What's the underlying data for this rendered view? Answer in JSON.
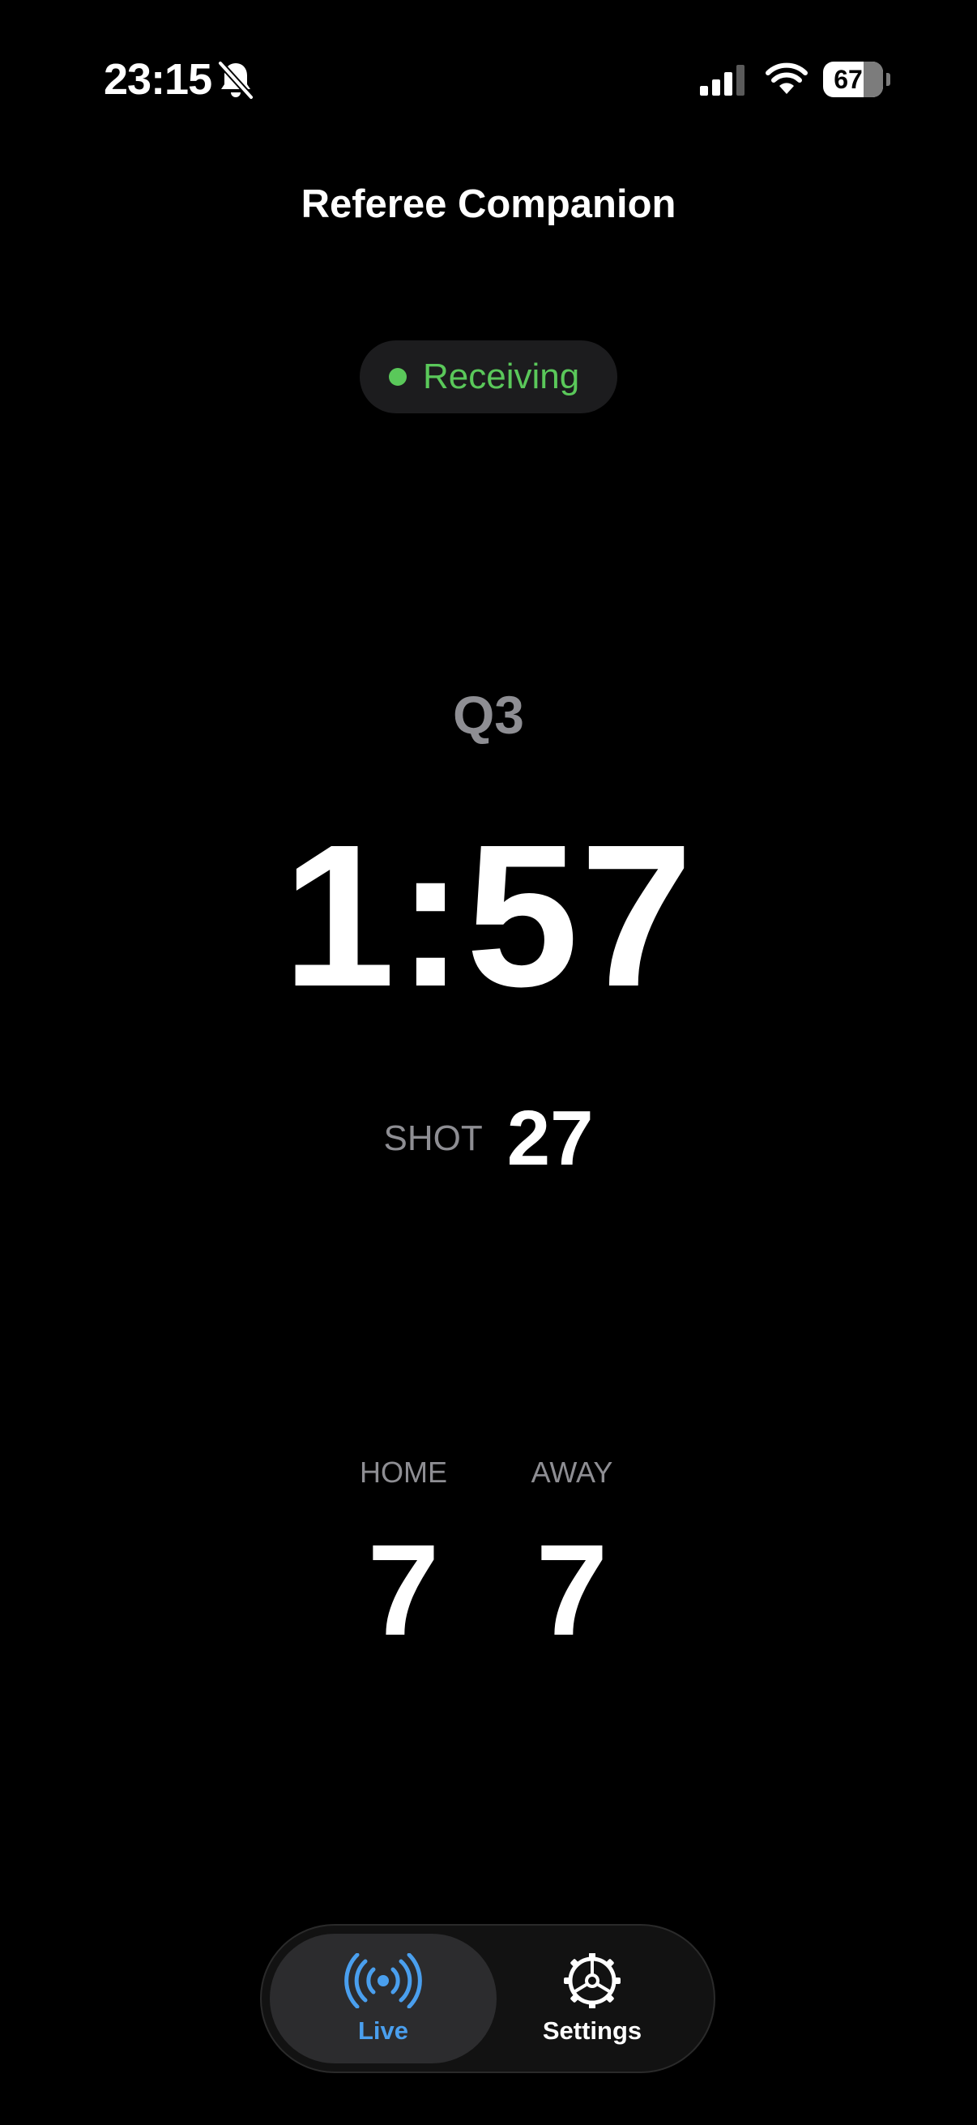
{
  "status_bar": {
    "time": "23:15",
    "mute_icon": "bell-slash-icon",
    "signal_icon": "cellular-signal-icon",
    "wifi_icon": "wifi-icon",
    "battery_percent": "67",
    "battery_level": 0.67
  },
  "header": {
    "title": "Referee Companion"
  },
  "connection": {
    "status": "Receiving",
    "status_color": "#5ac85a"
  },
  "game": {
    "quarter": "Q3",
    "clock": "1:57",
    "shot_label": "SHOT",
    "shot_value": "27",
    "home_label": "HOME",
    "home_score": "7",
    "away_label": "AWAY",
    "away_score": "7"
  },
  "tab_bar": {
    "active_color": "#4a9fee",
    "tabs": [
      {
        "label": "Live",
        "icon": "broadcast-icon",
        "selected": true
      },
      {
        "label": "Settings",
        "icon": "gear-icon",
        "selected": false
      }
    ]
  }
}
